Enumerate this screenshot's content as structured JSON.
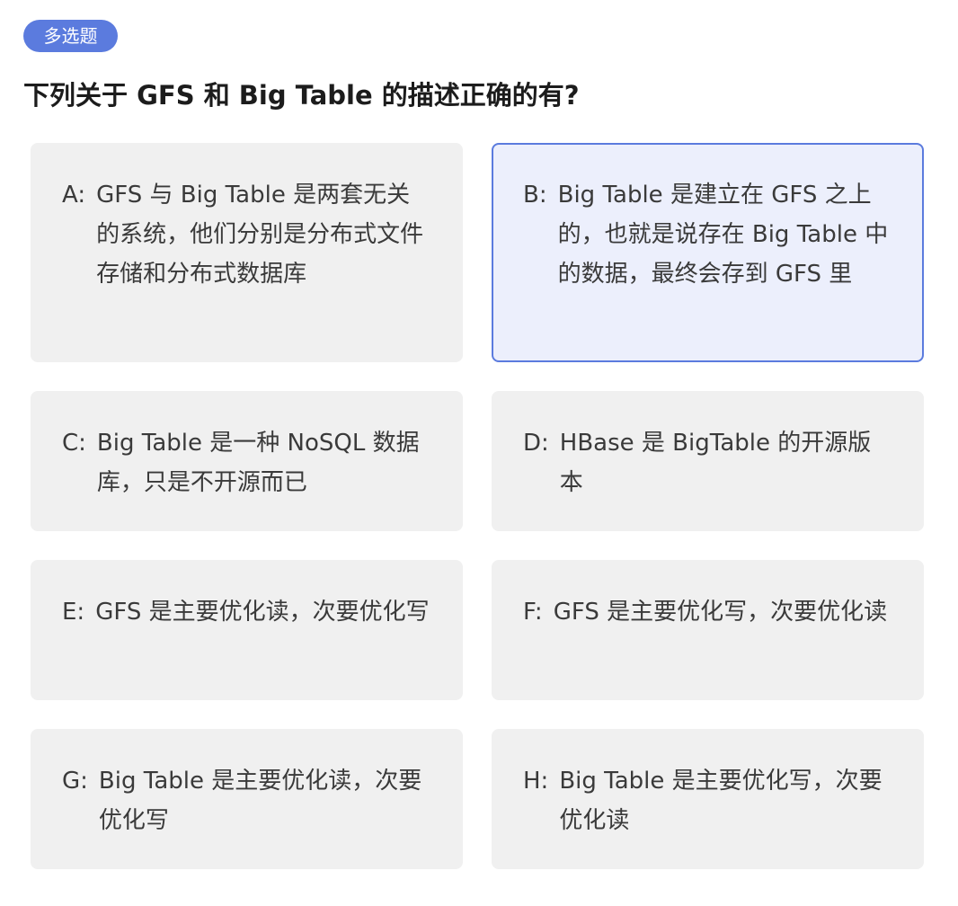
{
  "question_type": "多选题",
  "question_title": "下列关于 GFS 和 Big Table 的描述正确的有?",
  "options": [
    {
      "letter": "A:",
      "text": "GFS 与 Big Table 是两套无关的系统，他们分别是分布式文件存储和分布式数据库",
      "selected": false
    },
    {
      "letter": "B:",
      "text": "Big Table 是建立在 GFS 之上的，也就是说存在 Big Table 中的数据，最终会存到 GFS 里",
      "selected": true
    },
    {
      "letter": "C:",
      "text": "Big Table 是一种 NoSQL 数据库，只是不开源而已",
      "selected": false
    },
    {
      "letter": "D:",
      "text": "HBase 是 BigTable 的开源版本",
      "selected": false
    },
    {
      "letter": "E:",
      "text": "GFS 是主要优化读，次要优化写",
      "selected": false
    },
    {
      "letter": "F:",
      "text": "GFS 是主要优化写，次要优化读",
      "selected": false
    },
    {
      "letter": "G:",
      "text": "Big Table 是主要优化读，次要优化写",
      "selected": false
    },
    {
      "letter": "H:",
      "text": "Big Table 是主要优化写，次要优化读",
      "selected": false
    }
  ],
  "colors": {
    "accent": "#5b7bde",
    "option_bg": "#f0f0f0",
    "selected_bg": "#eceffc",
    "title_text": "#1c1c1c",
    "option_text": "#3a3a3a"
  }
}
